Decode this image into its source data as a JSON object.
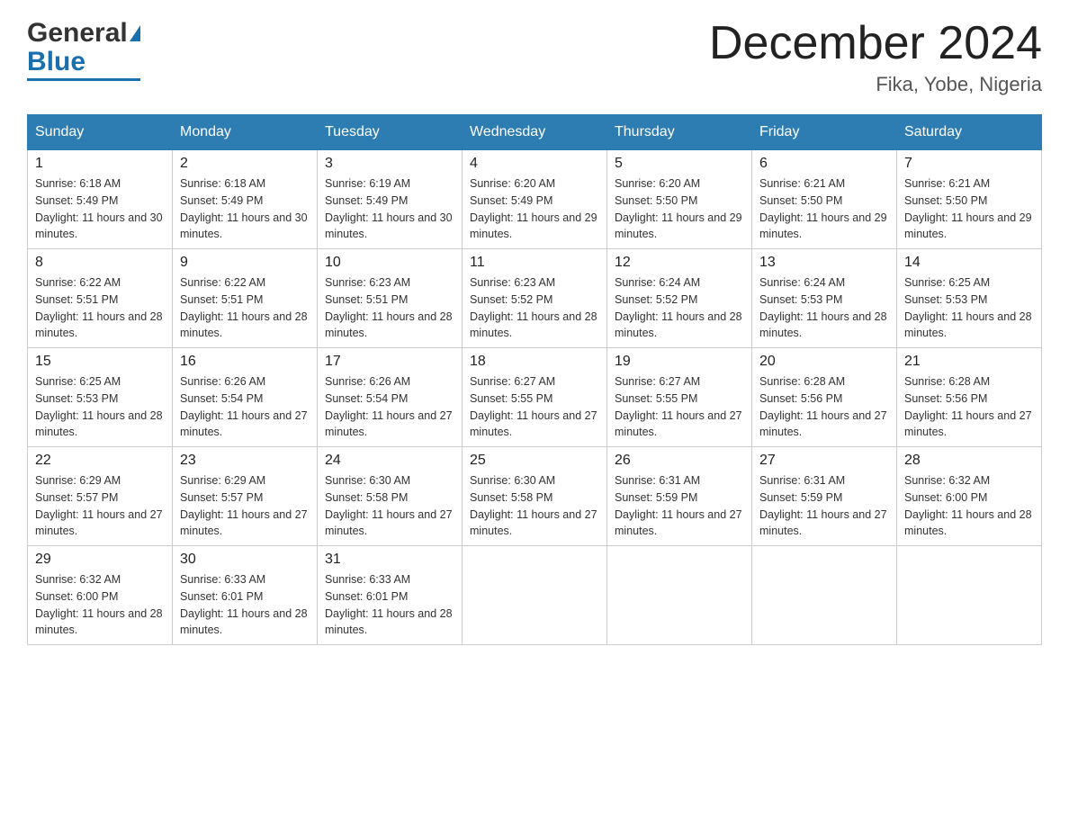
{
  "header": {
    "logo_general": "General",
    "logo_blue": "Blue",
    "month_title": "December 2024",
    "location": "Fika, Yobe, Nigeria"
  },
  "days_of_week": [
    "Sunday",
    "Monday",
    "Tuesday",
    "Wednesday",
    "Thursday",
    "Friday",
    "Saturday"
  ],
  "weeks": [
    [
      {
        "day": "1",
        "sunrise": "6:18 AM",
        "sunset": "5:49 PM",
        "daylight": "11 hours and 30 minutes."
      },
      {
        "day": "2",
        "sunrise": "6:18 AM",
        "sunset": "5:49 PM",
        "daylight": "11 hours and 30 minutes."
      },
      {
        "day": "3",
        "sunrise": "6:19 AM",
        "sunset": "5:49 PM",
        "daylight": "11 hours and 30 minutes."
      },
      {
        "day": "4",
        "sunrise": "6:20 AM",
        "sunset": "5:49 PM",
        "daylight": "11 hours and 29 minutes."
      },
      {
        "day": "5",
        "sunrise": "6:20 AM",
        "sunset": "5:50 PM",
        "daylight": "11 hours and 29 minutes."
      },
      {
        "day": "6",
        "sunrise": "6:21 AM",
        "sunset": "5:50 PM",
        "daylight": "11 hours and 29 minutes."
      },
      {
        "day": "7",
        "sunrise": "6:21 AM",
        "sunset": "5:50 PM",
        "daylight": "11 hours and 29 minutes."
      }
    ],
    [
      {
        "day": "8",
        "sunrise": "6:22 AM",
        "sunset": "5:51 PM",
        "daylight": "11 hours and 28 minutes."
      },
      {
        "day": "9",
        "sunrise": "6:22 AM",
        "sunset": "5:51 PM",
        "daylight": "11 hours and 28 minutes."
      },
      {
        "day": "10",
        "sunrise": "6:23 AM",
        "sunset": "5:51 PM",
        "daylight": "11 hours and 28 minutes."
      },
      {
        "day": "11",
        "sunrise": "6:23 AM",
        "sunset": "5:52 PM",
        "daylight": "11 hours and 28 minutes."
      },
      {
        "day": "12",
        "sunrise": "6:24 AM",
        "sunset": "5:52 PM",
        "daylight": "11 hours and 28 minutes."
      },
      {
        "day": "13",
        "sunrise": "6:24 AM",
        "sunset": "5:53 PM",
        "daylight": "11 hours and 28 minutes."
      },
      {
        "day": "14",
        "sunrise": "6:25 AM",
        "sunset": "5:53 PM",
        "daylight": "11 hours and 28 minutes."
      }
    ],
    [
      {
        "day": "15",
        "sunrise": "6:25 AM",
        "sunset": "5:53 PM",
        "daylight": "11 hours and 28 minutes."
      },
      {
        "day": "16",
        "sunrise": "6:26 AM",
        "sunset": "5:54 PM",
        "daylight": "11 hours and 27 minutes."
      },
      {
        "day": "17",
        "sunrise": "6:26 AM",
        "sunset": "5:54 PM",
        "daylight": "11 hours and 27 minutes."
      },
      {
        "day": "18",
        "sunrise": "6:27 AM",
        "sunset": "5:55 PM",
        "daylight": "11 hours and 27 minutes."
      },
      {
        "day": "19",
        "sunrise": "6:27 AM",
        "sunset": "5:55 PM",
        "daylight": "11 hours and 27 minutes."
      },
      {
        "day": "20",
        "sunrise": "6:28 AM",
        "sunset": "5:56 PM",
        "daylight": "11 hours and 27 minutes."
      },
      {
        "day": "21",
        "sunrise": "6:28 AM",
        "sunset": "5:56 PM",
        "daylight": "11 hours and 27 minutes."
      }
    ],
    [
      {
        "day": "22",
        "sunrise": "6:29 AM",
        "sunset": "5:57 PM",
        "daylight": "11 hours and 27 minutes."
      },
      {
        "day": "23",
        "sunrise": "6:29 AM",
        "sunset": "5:57 PM",
        "daylight": "11 hours and 27 minutes."
      },
      {
        "day": "24",
        "sunrise": "6:30 AM",
        "sunset": "5:58 PM",
        "daylight": "11 hours and 27 minutes."
      },
      {
        "day": "25",
        "sunrise": "6:30 AM",
        "sunset": "5:58 PM",
        "daylight": "11 hours and 27 minutes."
      },
      {
        "day": "26",
        "sunrise": "6:31 AM",
        "sunset": "5:59 PM",
        "daylight": "11 hours and 27 minutes."
      },
      {
        "day": "27",
        "sunrise": "6:31 AM",
        "sunset": "5:59 PM",
        "daylight": "11 hours and 27 minutes."
      },
      {
        "day": "28",
        "sunrise": "6:32 AM",
        "sunset": "6:00 PM",
        "daylight": "11 hours and 28 minutes."
      }
    ],
    [
      {
        "day": "29",
        "sunrise": "6:32 AM",
        "sunset": "6:00 PM",
        "daylight": "11 hours and 28 minutes."
      },
      {
        "day": "30",
        "sunrise": "6:33 AM",
        "sunset": "6:01 PM",
        "daylight": "11 hours and 28 minutes."
      },
      {
        "day": "31",
        "sunrise": "6:33 AM",
        "sunset": "6:01 PM",
        "daylight": "11 hours and 28 minutes."
      },
      null,
      null,
      null,
      null
    ]
  ],
  "labels": {
    "sunrise_prefix": "Sunrise: ",
    "sunset_prefix": "Sunset: ",
    "daylight_prefix": "Daylight: "
  }
}
